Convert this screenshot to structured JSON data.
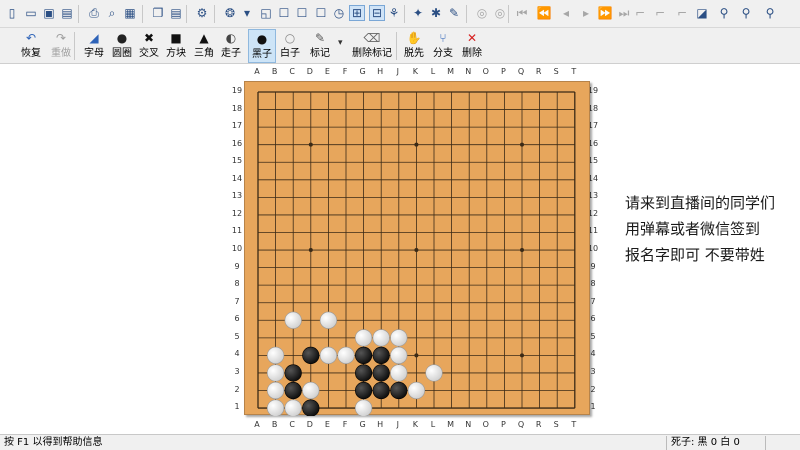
{
  "toolbar_top": {
    "icons": [
      "new-file-icon",
      "open-folder-icon",
      "save-icon",
      "properties-icon",
      "print-icon",
      "print-preview-icon",
      "export-icon",
      "copy-icon",
      "paste-icon",
      "settings-icon",
      "stone-color-icon",
      "dropdown-arrow-icon",
      "board-view-icon-1",
      "board-view-icon-2",
      "board-view-icon-3",
      "board-view-icon-4",
      "clock-icon",
      "sgf-mode-icon",
      "branch-mode-icon",
      "tree-icon",
      "magic-wand-icon",
      "score-icon",
      "brush-icon",
      "circle-icon-1",
      "circle-icon-2",
      "first-move-icon",
      "prev-variation-icon",
      "prev-move-icon",
      "next-move-icon",
      "next-variation-icon",
      "last-move-icon",
      "mark-icon-1",
      "mark-icon-2",
      "mark-icon-3",
      "board-edit-icon",
      "search-icon",
      "find-icon",
      "find-next-icon"
    ]
  },
  "toolbar_main": {
    "buttons": [
      {
        "label": "恢复",
        "icon": "↶",
        "name": "undo"
      },
      {
        "label": "重做",
        "icon": "↷",
        "name": "redo",
        "disabled": true
      },
      {
        "label": "字母",
        "icon": "◢",
        "name": "letter"
      },
      {
        "label": "圆圈",
        "icon": "●",
        "name": "circle"
      },
      {
        "label": "交叉",
        "icon": "✖",
        "name": "cross"
      },
      {
        "label": "方块",
        "icon": "■",
        "name": "square"
      },
      {
        "label": "三角",
        "icon": "▲",
        "name": "triangle"
      },
      {
        "label": "走子",
        "icon": "◐",
        "name": "move"
      },
      {
        "label": "黑子",
        "icon": "●",
        "name": "black-stone",
        "active": true
      },
      {
        "label": "白子",
        "icon": "○",
        "name": "white-stone"
      },
      {
        "label": "标记",
        "icon": "✎",
        "name": "mark"
      },
      {
        "label": "删除标记",
        "icon": "⌫",
        "name": "delete-mark"
      },
      {
        "label": "脱先",
        "icon": "✋",
        "name": "tenuki"
      },
      {
        "label": "分支",
        "icon": "⑂",
        "name": "branch"
      },
      {
        "label": "删除",
        "icon": "✕",
        "name": "delete"
      }
    ]
  },
  "board": {
    "size": 19,
    "column_labels": [
      "A",
      "B",
      "C",
      "D",
      "E",
      "F",
      "G",
      "H",
      "J",
      "K",
      "L",
      "M",
      "N",
      "O",
      "P",
      "Q",
      "R",
      "S",
      "T"
    ],
    "row_labels": [
      "19",
      "18",
      "17",
      "16",
      "15",
      "14",
      "13",
      "12",
      "11",
      "10",
      "9",
      "8",
      "7",
      "6",
      "5",
      "4",
      "3",
      "2",
      "1"
    ],
    "star_points": [
      "D16",
      "K16",
      "Q16",
      "D10",
      "K10",
      "Q10",
      "D4",
      "K4",
      "Q4"
    ],
    "black_stones": [
      "D4",
      "G4",
      "H4",
      "C3",
      "G3",
      "H3",
      "C2",
      "G2",
      "H2",
      "J2",
      "D1"
    ],
    "white_stones": [
      "C6",
      "E6",
      "G5",
      "H5",
      "J5",
      "B4",
      "E4",
      "F4",
      "J4",
      "B3",
      "J3",
      "L3",
      "B2",
      "D2",
      "K2",
      "B1",
      "C1",
      "G1"
    ]
  },
  "message": {
    "lines": [
      "请来到直播间的同学们",
      "用弹幕或者微信签到",
      "报名字即可 不要带姓"
    ]
  },
  "status": {
    "help": "按 F1 以得到帮助信息",
    "captures": "死子: 黑 0 白 0"
  },
  "colors": {
    "board": "#e7a65c",
    "line": "#3b2a16",
    "black_stone": "#111111",
    "white_stone": "#f7f7f7",
    "toolbar": "#f0f0f0"
  }
}
